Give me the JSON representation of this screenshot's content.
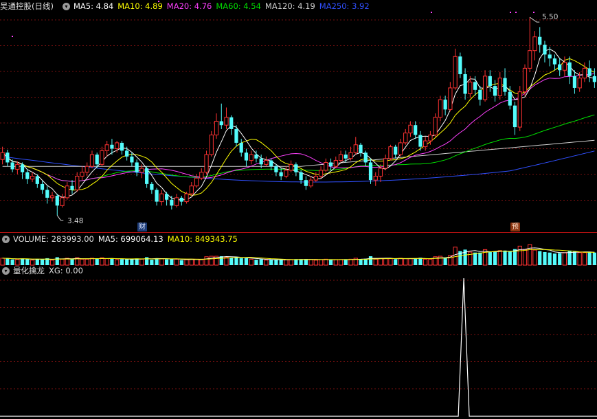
{
  "window": {
    "stock_name": "吴通控股(日线)",
    "price_panel": {
      "ma": [
        {
          "label": "MA5: ",
          "value": "4.84",
          "color": "#ffffff"
        },
        {
          "label": "MA10: ",
          "value": "4.89",
          "color": "#ffff00"
        },
        {
          "label": "MA20: ",
          "value": "4.76",
          "color": "#ff40ff"
        },
        {
          "label": "MA60: ",
          "value": "4.54",
          "color": "#00e000"
        },
        {
          "label": "MA120: ",
          "value": "4.19",
          "color": "#d0d0d0"
        },
        {
          "label": "MA250: ",
          "value": "3.92",
          "color": "#3050ff"
        }
      ],
      "high_annotation": "5.50",
      "low_annotation": "3.48",
      "event_tags": {
        "cai": "财",
        "yu": "预"
      }
    },
    "volume_panel": {
      "label": "VOLUME: ",
      "value": "283993.00",
      "ma5_label": "MA5: ",
      "ma5_value": "699064.13",
      "ma10_label": "MA10: ",
      "ma10_value": "849343.75"
    },
    "indicator_panel": {
      "name": "量化擒龙",
      "xg_label": "XG: ",
      "xg_value": "0.00"
    }
  },
  "colors": {
    "up": "#ff3232",
    "down": "#54fcfc",
    "grid": "#7a1010",
    "separator": "#b01010",
    "ma5": "#ffffff",
    "ma10": "#ffff00",
    "ma20": "#ff40ff",
    "ma60": "#00e000",
    "ma120": "#d0d0d0",
    "ma250": "#3050ff"
  },
  "icons": [
    "panel-toggle-icon"
  ],
  "chart_data": {
    "type": "candlestick",
    "y_range": [
      3.4,
      5.55
    ],
    "markers": {
      "cai_index": 29,
      "yu_index": 105,
      "xg_signal_index": 93
    },
    "candles": [
      [
        4.05,
        4.12,
        4.18,
        4.0
      ],
      [
        4.12,
        4.02,
        4.15,
        3.98
      ],
      [
        4.02,
        3.95,
        4.05,
        3.92
      ],
      [
        3.95,
        4.0,
        4.03,
        3.9
      ],
      [
        4.0,
        3.92,
        4.02,
        3.85
      ],
      [
        3.92,
        3.85,
        3.95,
        3.8
      ],
      [
        3.85,
        3.88,
        3.92,
        3.82
      ],
      [
        3.88,
        3.8,
        3.9,
        3.76
      ],
      [
        3.8,
        3.74,
        3.83,
        3.7
      ],
      [
        3.74,
        3.66,
        3.78,
        3.6
      ],
      [
        3.66,
        3.68,
        3.72,
        3.62
      ],
      [
        3.68,
        3.58,
        3.7,
        3.48
      ],
      [
        3.58,
        3.66,
        3.7,
        3.56
      ],
      [
        3.66,
        3.78,
        3.82,
        3.64
      ],
      [
        3.78,
        3.74,
        3.84,
        3.7
      ],
      [
        3.74,
        3.88,
        3.92,
        3.72
      ],
      [
        3.88,
        3.92,
        3.98,
        3.84
      ],
      [
        3.92,
        3.98,
        4.02,
        3.88
      ],
      [
        3.98,
        4.1,
        4.14,
        3.96
      ],
      [
        4.1,
        4.0,
        4.12,
        3.96
      ],
      [
        4.0,
        4.14,
        4.18,
        3.98
      ],
      [
        4.14,
        4.2,
        4.24,
        4.08
      ],
      [
        4.2,
        4.16,
        4.26,
        4.1
      ],
      [
        4.16,
        4.22,
        4.24,
        4.12
      ],
      [
        4.22,
        4.14,
        4.24,
        4.1
      ],
      [
        4.14,
        4.08,
        4.18,
        4.04
      ],
      [
        4.08,
        4.02,
        4.12,
        3.98
      ],
      [
        4.02,
        3.92,
        4.05,
        3.88
      ],
      [
        3.92,
        3.96,
        4.0,
        3.86
      ],
      [
        3.96,
        3.8,
        3.98,
        3.76
      ],
      [
        3.8,
        3.74,
        3.82,
        3.7
      ],
      [
        3.74,
        3.62,
        3.76,
        3.58
      ],
      [
        3.62,
        3.7,
        3.74,
        3.58
      ],
      [
        3.7,
        3.64,
        3.72,
        3.58
      ],
      [
        3.64,
        3.58,
        3.68,
        3.54
      ],
      [
        3.58,
        3.66,
        3.7,
        3.56
      ],
      [
        3.66,
        3.62,
        3.68,
        3.58
      ],
      [
        3.62,
        3.7,
        3.72,
        3.6
      ],
      [
        3.7,
        3.78,
        3.82,
        3.68
      ],
      [
        3.78,
        3.86,
        3.9,
        3.76
      ],
      [
        3.86,
        3.92,
        3.96,
        3.84
      ],
      [
        3.92,
        4.1,
        4.14,
        3.9
      ],
      [
        4.1,
        4.3,
        4.34,
        4.08
      ],
      [
        4.3,
        4.44,
        4.52,
        4.26
      ],
      [
        4.44,
        4.4,
        4.62,
        4.36
      ],
      [
        4.4,
        4.48,
        4.58,
        4.36
      ],
      [
        4.48,
        4.36,
        4.5,
        4.3
      ],
      [
        4.36,
        4.22,
        4.4,
        4.18
      ],
      [
        4.22,
        4.12,
        4.26,
        4.08
      ],
      [
        4.12,
        4.04,
        4.16,
        3.98
      ],
      [
        4.04,
        4.1,
        4.14,
        4.0
      ],
      [
        4.1,
        4.06,
        4.14,
        4.02
      ],
      [
        4.06,
        4.0,
        4.1,
        3.96
      ],
      [
        4.0,
        4.04,
        4.08,
        3.98
      ],
      [
        4.04,
        3.98,
        4.06,
        3.94
      ],
      [
        3.98,
        3.92,
        4.0,
        3.88
      ],
      [
        3.92,
        3.88,
        3.96,
        3.84
      ],
      [
        3.88,
        3.94,
        3.98,
        3.86
      ],
      [
        3.94,
        4.0,
        4.04,
        3.92
      ],
      [
        4.0,
        3.92,
        4.02,
        3.88
      ],
      [
        3.92,
        3.84,
        3.94,
        3.8
      ],
      [
        3.84,
        3.78,
        3.88,
        3.74
      ],
      [
        3.78,
        3.84,
        3.88,
        3.76
      ],
      [
        3.84,
        3.88,
        3.92,
        3.82
      ],
      [
        3.88,
        3.94,
        3.98,
        3.86
      ],
      [
        3.94,
        4.02,
        4.06,
        3.92
      ],
      [
        4.02,
        3.98,
        4.06,
        3.94
      ],
      [
        3.98,
        4.04,
        4.08,
        3.96
      ],
      [
        4.04,
        4.1,
        4.14,
        4.02
      ],
      [
        4.1,
        4.06,
        4.14,
        4.02
      ],
      [
        4.06,
        4.12,
        4.18,
        4.04
      ],
      [
        4.12,
        4.2,
        4.28,
        4.1
      ],
      [
        4.2,
        4.12,
        4.22,
        4.08
      ],
      [
        4.12,
        4.02,
        4.14,
        3.98
      ],
      [
        4.02,
        3.84,
        4.06,
        3.8
      ],
      [
        3.84,
        3.88,
        3.92,
        3.78
      ],
      [
        3.88,
        3.96,
        4.0,
        3.82
      ],
      [
        3.96,
        4.06,
        4.1,
        3.94
      ],
      [
        4.06,
        4.18,
        4.2,
        4.04
      ],
      [
        4.18,
        4.1,
        4.2,
        4.06
      ],
      [
        4.1,
        4.22,
        4.26,
        4.08
      ],
      [
        4.22,
        4.32,
        4.36,
        4.2
      ],
      [
        4.32,
        4.4,
        4.44,
        4.28
      ],
      [
        4.4,
        4.3,
        4.44,
        4.26
      ],
      [
        4.3,
        4.18,
        4.34,
        4.14
      ],
      [
        4.18,
        4.24,
        4.28,
        4.14
      ],
      [
        4.24,
        4.3,
        4.34,
        4.2
      ],
      [
        4.3,
        4.48,
        4.52,
        4.28
      ],
      [
        4.48,
        4.66,
        4.7,
        4.44
      ],
      [
        4.66,
        4.56,
        4.7,
        4.5
      ],
      [
        4.56,
        4.78,
        4.84,
        4.54
      ],
      [
        4.78,
        5.1,
        5.18,
        4.76
      ],
      [
        5.1,
        4.92,
        5.14,
        4.88
      ],
      [
        4.92,
        4.72,
        4.98,
        4.66
      ],
      [
        4.72,
        4.84,
        4.9,
        4.68
      ],
      [
        4.84,
        4.76,
        4.9,
        4.7
      ],
      [
        4.76,
        4.66,
        4.8,
        4.6
      ],
      [
        4.66,
        4.9,
        4.96,
        4.64
      ],
      [
        4.9,
        4.8,
        4.96,
        4.74
      ],
      [
        4.8,
        4.7,
        4.86,
        4.64
      ],
      [
        4.7,
        4.88,
        4.94,
        4.66
      ],
      [
        4.88,
        4.74,
        4.98,
        4.7
      ],
      [
        4.74,
        4.6,
        4.8,
        4.56
      ],
      [
        4.6,
        4.38,
        4.64,
        4.3
      ],
      [
        4.38,
        4.74,
        4.8,
        4.34
      ],
      [
        4.74,
        4.98,
        5.02,
        4.7
      ],
      [
        4.98,
        5.16,
        5.5,
        4.94
      ],
      [
        5.16,
        5.3,
        5.36,
        5.06
      ],
      [
        5.3,
        5.22,
        5.4,
        5.14
      ],
      [
        5.22,
        5.12,
        5.26,
        5.04
      ],
      [
        5.12,
        5.08,
        5.2,
        5.0
      ],
      [
        5.08,
        5.02,
        5.12,
        4.96
      ],
      [
        5.02,
        4.96,
        5.08,
        4.9
      ],
      [
        4.96,
        5.04,
        5.1,
        4.9
      ],
      [
        5.04,
        4.9,
        5.1,
        4.82
      ],
      [
        4.9,
        4.78,
        4.96,
        4.72
      ],
      [
        4.78,
        4.88,
        4.94,
        4.74
      ],
      [
        4.88,
        4.98,
        5.04,
        4.84
      ],
      [
        4.98,
        4.9,
        5.06,
        4.84
      ],
      [
        4.9,
        4.84,
        4.98,
        4.78
      ]
    ]
  }
}
